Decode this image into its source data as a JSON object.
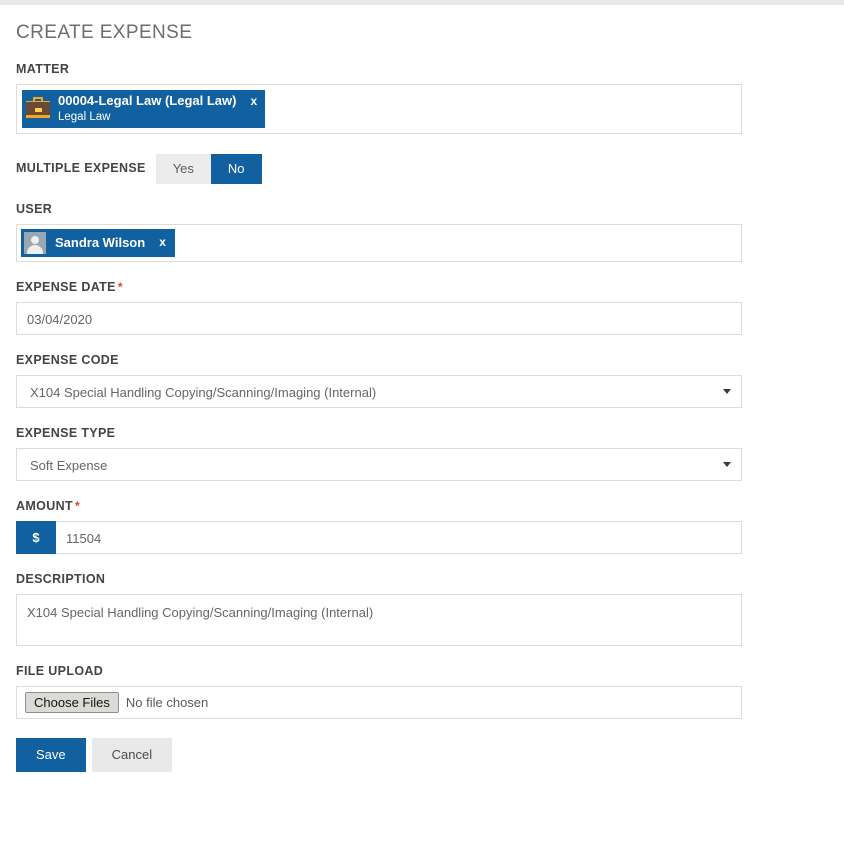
{
  "page": {
    "title": "CREATE EXPENSE"
  },
  "colors": {
    "accent_blue": "#11609f",
    "required_red": "#e23b3b",
    "label_gray": "#444444",
    "title_gray": "#6d6d6d",
    "border_gray": "#dcdcdc",
    "toggle_inactive": "#ececec",
    "cancel_bg": "#e9e9e9"
  },
  "fields": {
    "matter": {
      "label": "MATTER",
      "token": {
        "icon": "briefcase-icon",
        "title": "00004-Legal Law (Legal Law)",
        "subtitle": "Legal Law",
        "remove": "x"
      }
    },
    "multiple_expense": {
      "label": "MULTIPLE EXPENSE",
      "options": [
        "Yes",
        "No"
      ],
      "selected": "No"
    },
    "user": {
      "label": "USER",
      "token": {
        "icon": "user-avatar-icon",
        "title": "Sandra Wilson",
        "remove": "x"
      }
    },
    "expense_date": {
      "label": "EXPENSE DATE",
      "required": true,
      "required_mark": "*",
      "value": "03/04/2020"
    },
    "expense_code": {
      "label": "EXPENSE CODE",
      "required": false,
      "value": "X104 Special Handling Copying/Scanning/Imaging (Internal)"
    },
    "expense_type": {
      "label": "EXPENSE TYPE",
      "required": false,
      "value": "Soft Expense"
    },
    "amount": {
      "label": "AMOUNT",
      "required": true,
      "required_mark": "*",
      "currency_symbol": "$",
      "value": "11504"
    },
    "description": {
      "label": "DESCRIPTION",
      "value": "X104 Special Handling Copying/Scanning/Imaging (Internal)"
    },
    "file_upload": {
      "label": "FILE UPLOAD",
      "button_label": "Choose Files",
      "status": "No file chosen"
    }
  },
  "actions": {
    "save_label": "Save",
    "cancel_label": "Cancel"
  }
}
